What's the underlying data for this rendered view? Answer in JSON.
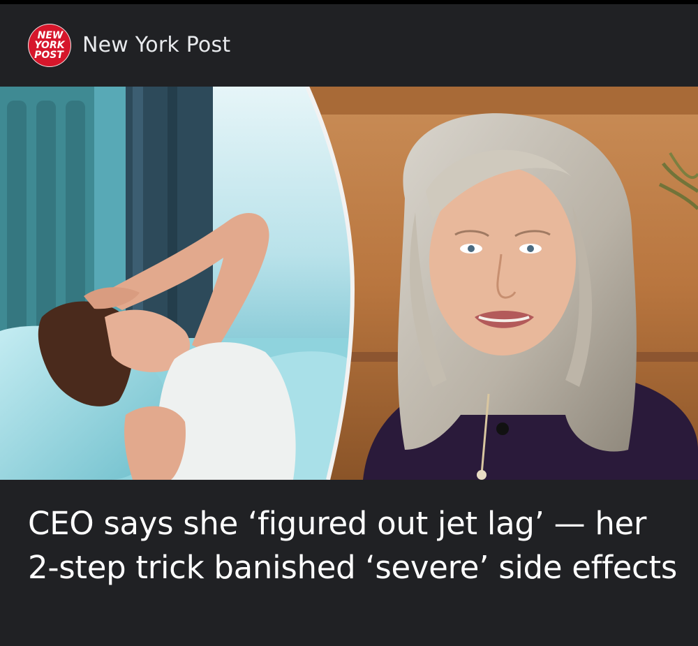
{
  "source": {
    "logo_text": "NEW YORK POST",
    "name": "New York Post",
    "brand_color": "#d6162b"
  },
  "hero_image": {
    "left_panel": "woman-lying-in-bed-hand-on-forehead",
    "right_panel": "gray-haired-woman-speaking"
  },
  "article": {
    "headline": "CEO says she ‘figured out jet lag’ — her 2-step trick banished ‘severe’ side effects"
  },
  "colors": {
    "card_background": "#202124",
    "headline_text": "#ffffff",
    "source_text": "#e8eaed"
  }
}
